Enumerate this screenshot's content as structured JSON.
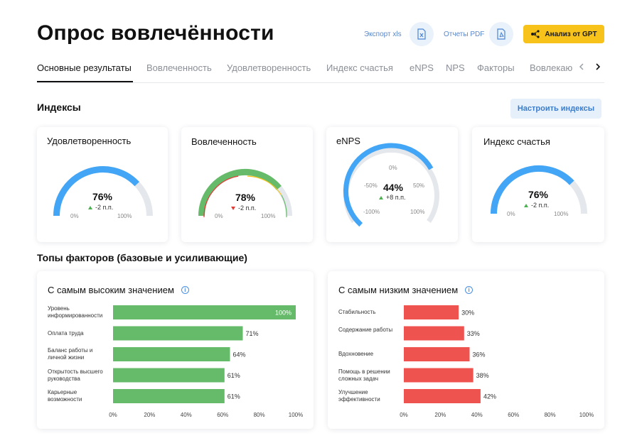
{
  "header": {
    "title": "Опрос вовлечённости",
    "export_xls": "Экспорт xls",
    "reports_pdf": "Отчеты PDF",
    "gpt_button": "Анализ от GPT"
  },
  "tabs": [
    {
      "label": "Основные результаты",
      "active": true
    },
    {
      "label": "Вовлеченность"
    },
    {
      "label": "Удовлетворенность"
    },
    {
      "label": "Индекс счастья"
    },
    {
      "label": "eNPS"
    },
    {
      "label": "NPS"
    },
    {
      "label": "Факторы"
    },
    {
      "label": "Вовлекаю"
    }
  ],
  "indexes": {
    "section_title": "Индексы",
    "configure_button": "Настроить индексы",
    "cards": [
      {
        "title": "Удовлетворенность",
        "value": "76%",
        "delta": "-2 п.п.",
        "trend": "up",
        "fraction": 0.76,
        "min": "0%",
        "max": "100%"
      },
      {
        "title": "Вовлеченность",
        "value": "78%",
        "delta": "-2 п.п.",
        "trend": "down",
        "fraction": 0.78,
        "min": "0%",
        "max": "100%"
      },
      {
        "title": "eNPS",
        "value": "44%",
        "delta": "+8 п.п.",
        "trend": "up",
        "fraction": 0.72,
        "ticks": [
          "-100%",
          "-50%",
          "0%",
          "50%",
          "100%"
        ]
      },
      {
        "title": "Индекс счастья",
        "value": "76%",
        "delta": "-2 п.п.",
        "trend": "up",
        "fraction": 0.76,
        "min": "0%",
        "max": "100%"
      }
    ]
  },
  "factors": {
    "section_title": "Топы факторов (базовые и усиливающие)",
    "axis_ticks": [
      "0%",
      "20%",
      "40%",
      "60%",
      "80%",
      "100%"
    ]
  },
  "colors": {
    "accent": "#42a5f5",
    "gauge_bg": "#e4e7eb",
    "green": "#66bb6a",
    "red": "#ef5350",
    "yellow": "#f7c21a"
  },
  "chart_data": [
    {
      "type": "bar",
      "title": "С самым высоким значением",
      "categories": [
        "Уровень информированности",
        "Оплата труда",
        "Баланс работы и личной жизни",
        "Открытость высшего руководства",
        "Карьерные возможности"
      ],
      "labels": [
        "100%",
        "71%",
        "64%",
        "61%",
        "61%"
      ],
      "values": [
        100,
        71,
        64,
        61,
        61
      ],
      "xlim": [
        0,
        100
      ]
    },
    {
      "type": "bar",
      "title": "С самым низким значением",
      "categories": [
        "Стабильность",
        "Содержание работы",
        "Вдохновение",
        "Помощь в решении сложных задач",
        "Улучшение эффективности"
      ],
      "labels": [
        "30%",
        "33%",
        "36%",
        "38%",
        "42%"
      ],
      "values": [
        30,
        33,
        36,
        38,
        42
      ],
      "xlim": [
        0,
        100
      ]
    }
  ]
}
